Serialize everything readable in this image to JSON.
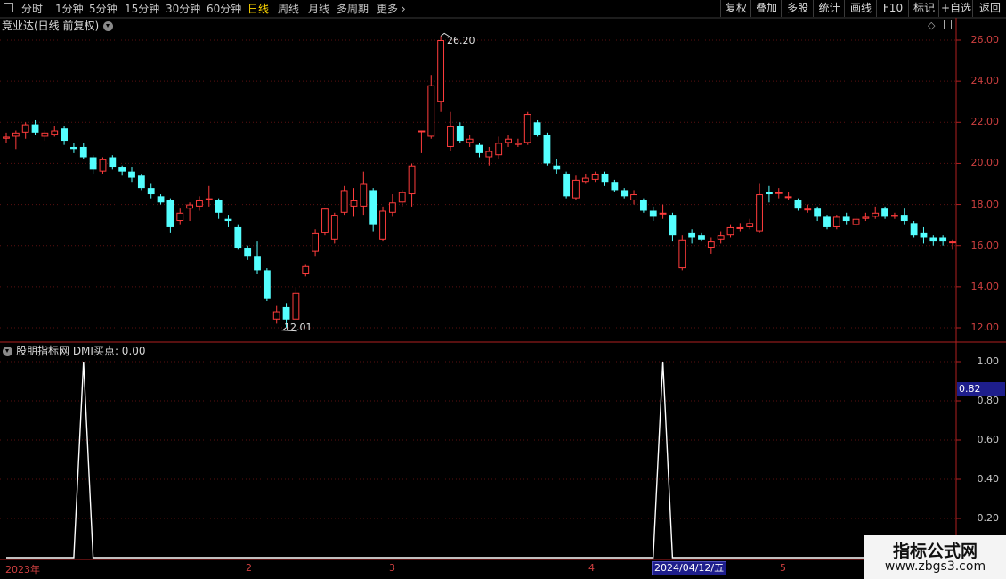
{
  "toolbar": {
    "periods": [
      "分时",
      "1分钟",
      "5分钟",
      "15分钟",
      "30分钟",
      "60分钟",
      "日线",
      "周线",
      "月线",
      "多周期",
      "更多"
    ],
    "active_period": "日线",
    "right_buttons": [
      "复权",
      "叠加",
      "多股",
      "统计",
      "画线",
      "F10",
      "标记",
      "+自选",
      "返回"
    ]
  },
  "main_panel": {
    "title": "竞业达(日线 前复权)",
    "y_labels": [
      "26.00",
      "24.00",
      "22.00",
      "20.00",
      "18.00",
      "16.00",
      "14.00",
      "12.00"
    ],
    "high_label": "26.20",
    "low_label": "12.01"
  },
  "indicator_panel": {
    "title": "股朋指标网  DMI买点: 0.00",
    "y_labels": [
      "1.00",
      "0.80",
      "0.60",
      "0.40",
      "0.20"
    ],
    "cursor_value": "0.82"
  },
  "x_axis": {
    "labels": [
      "2023年",
      "2",
      "3",
      "4",
      "5"
    ],
    "cursor_date": "2024/04/12/五"
  },
  "watermark": {
    "title": "指标公式网",
    "url": "www.zbgs3.com"
  },
  "colors": {
    "up": "#ff3c3c",
    "down": "#54ffff",
    "axis": "#b02020",
    "highlight_box": "#1e1e8c"
  },
  "chart_data": {
    "type": "candlestick",
    "title": "竞业达(日线 前复权)",
    "ylim": [
      11.5,
      26.6
    ],
    "candles": [
      {
        "o": 21.2,
        "c": 21.3,
        "h": 21.5,
        "l": 21.0
      },
      {
        "o": 21.3,
        "c": 21.5,
        "h": 21.6,
        "l": 20.7
      },
      {
        "o": 21.5,
        "c": 21.9,
        "h": 22.0,
        "l": 21.2
      },
      {
        "o": 21.9,
        "c": 21.5,
        "h": 22.1,
        "l": 21.4
      },
      {
        "o": 21.3,
        "c": 21.5,
        "h": 21.6,
        "l": 21.1
      },
      {
        "o": 21.4,
        "c": 21.6,
        "h": 21.8,
        "l": 21.3
      },
      {
        "o": 21.7,
        "c": 21.1,
        "h": 21.8,
        "l": 20.9
      },
      {
        "o": 20.8,
        "c": 20.7,
        "h": 21.0,
        "l": 20.5
      },
      {
        "o": 20.8,
        "c": 20.3,
        "h": 21.0,
        "l": 20.2
      },
      {
        "o": 20.3,
        "c": 19.7,
        "h": 20.4,
        "l": 19.5
      },
      {
        "o": 19.6,
        "c": 20.2,
        "h": 20.3,
        "l": 19.5
      },
      {
        "o": 20.3,
        "c": 19.8,
        "h": 20.4,
        "l": 19.7
      },
      {
        "o": 19.8,
        "c": 19.6,
        "h": 19.9,
        "l": 19.4
      },
      {
        "o": 19.6,
        "c": 19.3,
        "h": 19.8,
        "l": 19.1
      },
      {
        "o": 19.4,
        "c": 18.8,
        "h": 19.5,
        "l": 18.7
      },
      {
        "o": 18.8,
        "c": 18.5,
        "h": 19.0,
        "l": 18.3
      },
      {
        "o": 18.4,
        "c": 18.1,
        "h": 18.5,
        "l": 18.0
      },
      {
        "o": 18.2,
        "c": 16.9,
        "h": 18.3,
        "l": 16.6
      },
      {
        "o": 17.2,
        "c": 17.6,
        "h": 17.8,
        "l": 17.0
      },
      {
        "o": 17.8,
        "c": 18.0,
        "h": 18.1,
        "l": 17.2
      },
      {
        "o": 17.9,
        "c": 18.2,
        "h": 18.4,
        "l": 17.7
      },
      {
        "o": 18.3,
        "c": 18.3,
        "h": 18.9,
        "l": 17.9
      },
      {
        "o": 18.2,
        "c": 17.6,
        "h": 18.3,
        "l": 17.3
      },
      {
        "o": 17.3,
        "c": 17.2,
        "h": 17.5,
        "l": 16.9
      },
      {
        "o": 16.9,
        "c": 15.9,
        "h": 17.0,
        "l": 15.8
      },
      {
        "o": 15.9,
        "c": 15.5,
        "h": 16.0,
        "l": 15.3
      },
      {
        "o": 15.5,
        "c": 14.8,
        "h": 16.2,
        "l": 14.6
      },
      {
        "o": 14.8,
        "c": 13.4,
        "h": 14.9,
        "l": 13.3
      },
      {
        "o": 12.4,
        "c": 12.8,
        "h": 13.1,
        "l": 12.2
      },
      {
        "o": 13.0,
        "c": 12.4,
        "h": 13.2,
        "l": 12.01
      },
      {
        "o": 12.4,
        "c": 13.7,
        "h": 14.0,
        "l": 12.4
      },
      {
        "o": 14.6,
        "c": 15.0,
        "h": 15.1,
        "l": 14.5
      },
      {
        "o": 15.7,
        "c": 16.6,
        "h": 16.8,
        "l": 15.5
      },
      {
        "o": 16.6,
        "c": 17.8,
        "h": 17.8,
        "l": 16.5
      },
      {
        "o": 16.3,
        "c": 17.5,
        "h": 17.6,
        "l": 16.1
      },
      {
        "o": 17.6,
        "c": 18.7,
        "h": 18.9,
        "l": 17.5
      },
      {
        "o": 17.9,
        "c": 18.2,
        "h": 18.8,
        "l": 17.4
      },
      {
        "o": 17.9,
        "c": 19.0,
        "h": 19.6,
        "l": 17.5
      },
      {
        "o": 18.7,
        "c": 17.0,
        "h": 18.8,
        "l": 16.7
      },
      {
        "o": 16.3,
        "c": 17.7,
        "h": 17.9,
        "l": 16.2
      },
      {
        "o": 17.6,
        "c": 18.1,
        "h": 18.5,
        "l": 17.4
      },
      {
        "o": 18.1,
        "c": 18.6,
        "h": 18.7,
        "l": 17.9
      },
      {
        "o": 18.5,
        "c": 19.9,
        "h": 20.0,
        "l": 17.9
      },
      {
        "o": 21.6,
        "c": 21.6,
        "h": 21.6,
        "l": 20.5
      },
      {
        "o": 21.3,
        "c": 23.8,
        "h": 24.3,
        "l": 21.2
      },
      {
        "o": 23.0,
        "c": 26.0,
        "h": 26.2,
        "l": 22.5
      },
      {
        "o": 20.8,
        "c": 21.8,
        "h": 22.5,
        "l": 20.6
      },
      {
        "o": 21.8,
        "c": 21.1,
        "h": 22.0,
        "l": 21.0
      },
      {
        "o": 21.0,
        "c": 21.2,
        "h": 21.4,
        "l": 20.8
      },
      {
        "o": 20.9,
        "c": 20.5,
        "h": 21.0,
        "l": 20.3
      },
      {
        "o": 20.3,
        "c": 20.6,
        "h": 20.8,
        "l": 19.9
      },
      {
        "o": 20.4,
        "c": 21.0,
        "h": 21.3,
        "l": 20.2
      },
      {
        "o": 21.0,
        "c": 21.2,
        "h": 21.4,
        "l": 20.8
      },
      {
        "o": 20.9,
        "c": 21.0,
        "h": 21.2,
        "l": 20.8
      },
      {
        "o": 21.0,
        "c": 22.4,
        "h": 22.5,
        "l": 20.9
      },
      {
        "o": 22.0,
        "c": 21.4,
        "h": 22.1,
        "l": 21.3
      },
      {
        "o": 21.4,
        "c": 20.0,
        "h": 21.5,
        "l": 19.9
      },
      {
        "o": 19.9,
        "c": 19.7,
        "h": 20.2,
        "l": 19.5
      },
      {
        "o": 19.5,
        "c": 18.4,
        "h": 19.6,
        "l": 18.3
      },
      {
        "o": 18.3,
        "c": 19.2,
        "h": 19.4,
        "l": 18.2
      },
      {
        "o": 19.1,
        "c": 19.3,
        "h": 19.5,
        "l": 19.0
      },
      {
        "o": 19.2,
        "c": 19.5,
        "h": 19.6,
        "l": 19.1
      },
      {
        "o": 19.5,
        "c": 19.1,
        "h": 19.6,
        "l": 18.9
      },
      {
        "o": 19.1,
        "c": 18.7,
        "h": 19.2,
        "l": 18.6
      },
      {
        "o": 18.7,
        "c": 18.4,
        "h": 18.8,
        "l": 18.3
      },
      {
        "o": 18.2,
        "c": 18.5,
        "h": 18.7,
        "l": 18.0
      },
      {
        "o": 18.2,
        "c": 17.7,
        "h": 18.3,
        "l": 17.6
      },
      {
        "o": 17.7,
        "c": 17.4,
        "h": 17.9,
        "l": 17.2
      },
      {
        "o": 17.6,
        "c": 17.6,
        "h": 18.0,
        "l": 17.3
      },
      {
        "o": 17.5,
        "c": 16.5,
        "h": 17.6,
        "l": 16.2
      },
      {
        "o": 14.9,
        "c": 16.3,
        "h": 16.5,
        "l": 14.8
      },
      {
        "o": 16.6,
        "c": 16.4,
        "h": 16.8,
        "l": 16.1
      },
      {
        "o": 16.5,
        "c": 16.3,
        "h": 16.6,
        "l": 16.2
      },
      {
        "o": 15.9,
        "c": 16.2,
        "h": 16.4,
        "l": 15.6
      },
      {
        "o": 16.3,
        "c": 16.5,
        "h": 16.7,
        "l": 16.1
      },
      {
        "o": 16.5,
        "c": 16.9,
        "h": 17.0,
        "l": 16.4
      },
      {
        "o": 16.9,
        "c": 16.9,
        "h": 17.1,
        "l": 16.7
      },
      {
        "o": 16.9,
        "c": 17.1,
        "h": 17.3,
        "l": 16.8
      },
      {
        "o": 16.7,
        "c": 18.5,
        "h": 19.0,
        "l": 16.6
      },
      {
        "o": 18.6,
        "c": 18.5,
        "h": 18.9,
        "l": 18.1
      },
      {
        "o": 18.6,
        "c": 18.6,
        "h": 18.8,
        "l": 18.3
      },
      {
        "o": 18.4,
        "c": 18.4,
        "h": 18.6,
        "l": 18.2
      },
      {
        "o": 18.2,
        "c": 17.8,
        "h": 18.3,
        "l": 17.7
      },
      {
        "o": 17.8,
        "c": 17.8,
        "h": 18.0,
        "l": 17.6
      },
      {
        "o": 17.8,
        "c": 17.4,
        "h": 17.9,
        "l": 17.2
      },
      {
        "o": 17.4,
        "c": 16.9,
        "h": 17.5,
        "l": 16.8
      },
      {
        "o": 16.9,
        "c": 17.4,
        "h": 17.5,
        "l": 16.8
      },
      {
        "o": 17.4,
        "c": 17.2,
        "h": 17.6,
        "l": 17.0
      },
      {
        "o": 17.0,
        "c": 17.3,
        "h": 17.4,
        "l": 16.9
      },
      {
        "o": 17.3,
        "c": 17.4,
        "h": 17.6,
        "l": 17.2
      },
      {
        "o": 17.4,
        "c": 17.6,
        "h": 17.9,
        "l": 17.3
      },
      {
        "o": 17.8,
        "c": 17.4,
        "h": 17.9,
        "l": 17.3
      },
      {
        "o": 17.4,
        "c": 17.5,
        "h": 17.6,
        "l": 17.3
      },
      {
        "o": 17.5,
        "c": 17.2,
        "h": 17.8,
        "l": 17.0
      },
      {
        "o": 17.1,
        "c": 16.5,
        "h": 17.2,
        "l": 16.4
      },
      {
        "o": 16.6,
        "c": 16.4,
        "h": 16.9,
        "l": 16.1
      },
      {
        "o": 16.4,
        "c": 16.2,
        "h": 16.5,
        "l": 16.0
      },
      {
        "o": 16.4,
        "c": 16.2,
        "h": 16.5,
        "l": 16.0
      },
      {
        "o": 16.2,
        "c": 16.2,
        "h": 16.3,
        "l": 15.8
      }
    ],
    "indicator": {
      "name": "DMI买点",
      "ylim": [
        0,
        1.1
      ],
      "values_nonzero": [
        {
          "index": 8,
          "value": 1.0
        },
        {
          "index": 68,
          "value": 1.0
        }
      ]
    }
  }
}
